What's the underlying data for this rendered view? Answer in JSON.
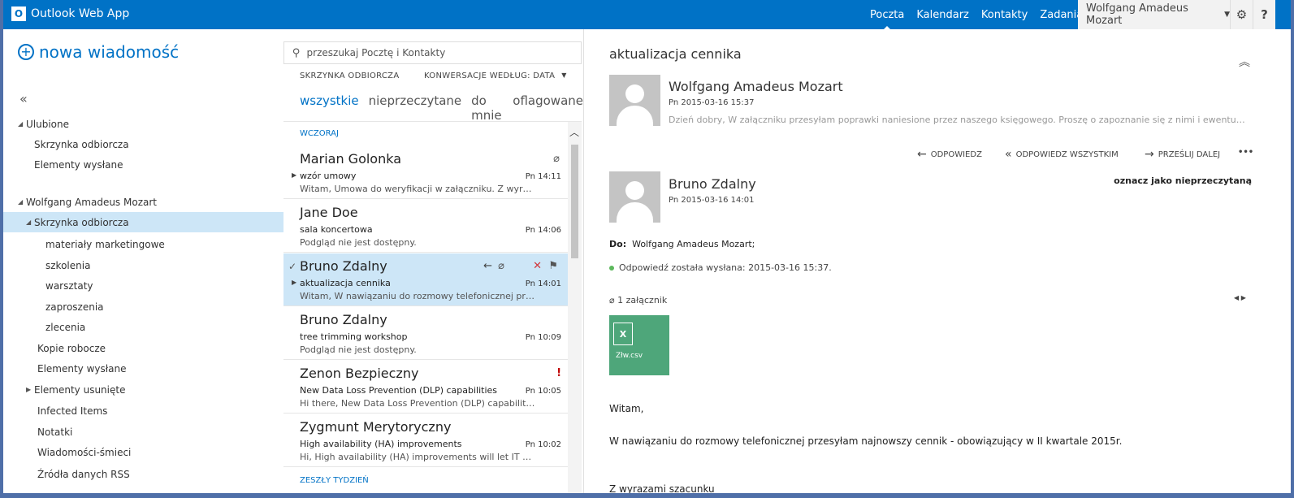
{
  "app": {
    "title": "Outlook Web App",
    "logo_letter": "O"
  },
  "nav": {
    "mail": "Poczta",
    "calendar": "Kalendarz",
    "contacts": "Kontakty",
    "tasks": "Zadania"
  },
  "user": {
    "name": "Wolfgang Amadeus Mozart"
  },
  "toolbar": {
    "gear": "⚙",
    "help": "?"
  },
  "sidebar": {
    "new_message": "nowa wiadomość",
    "favorites_header": "Ulubione",
    "favorites": [
      "Skrzynka odbiorcza",
      "Elementy wysłane"
    ],
    "account": "Wolfgang Amadeus Mozart",
    "inbox": "Skrzynka odbiorcza",
    "subfolders": [
      "materiały marketingowe",
      "szkolenia",
      "warsztaty",
      "zaproszenia",
      "zlecenia"
    ],
    "folders": [
      "Kopie robocze",
      "Elementy wysłane",
      "Elementy usunięte",
      "Infected Items",
      "Notatki",
      "Wiadomości-śmieci",
      "Źródła danych RSS"
    ]
  },
  "search": {
    "placeholder": "przeszukaj Pocztę i Kontakty"
  },
  "list": {
    "folder_label": "SKRZYNKA ODBIORCZA",
    "sort_label": "KONWERSACJE WEDŁUG: DATA",
    "filters": [
      "wszystkie",
      "nieprzeczytane",
      "do mnie",
      "oflagowane"
    ],
    "group_yesterday": "WCZORAJ",
    "group_last_week": "ZESZŁY TYDZIEŃ",
    "items": [
      {
        "sender": "Marian Golonka",
        "subject": "wzór umowy",
        "preview": "Witam, Umowa do weryfikacji w załączniku. Z wyrazami szacunku",
        "time": "Pn 14:11"
      },
      {
        "sender": "Jane Doe",
        "subject": "sala koncertowa",
        "preview": "Podgląd nie jest dostępny.",
        "time": "Pn 14:06"
      },
      {
        "sender": "Bruno Zdalny",
        "subject": "aktualizacja cennika",
        "preview": "Witam, W nawiązaniu do rozmowy telefonicznej przesyłam",
        "time": "Pn 14:01"
      },
      {
        "sender": "Bruno Zdalny",
        "subject": "tree trimming workshop",
        "preview": "Podgląd nie jest dostępny.",
        "time": "Pn 10:09"
      },
      {
        "sender": "Zenon Bezpieczny",
        "subject": "New Data Loss Prevention (DLP) capabilities",
        "preview": "Hi there, New Data Loss Prevention (DLP) capabilities will",
        "time": "Pn 10:05"
      },
      {
        "sender": "Zygmunt Merytoryczny",
        "subject": "High availability (HA) improvements",
        "preview": "Hi, High availability (HA) improvements will let IT pro...",
        "time": "Pn 10:02"
      }
    ]
  },
  "reading": {
    "title": "aktualizacja cennika",
    "msg1": {
      "from": "Wolfgang Amadeus Mozart",
      "date": "Pn 2015-03-16 15:37",
      "preview": "Dzień dobry, W załączniku przesyłam poprawki naniesione przez naszego księgowego. Proszę o zapoznanie się z nimi i ewentualny komentarz."
    },
    "actions": {
      "reply": "ODPOWIEDZ",
      "reply_all": "ODPOWIEDZ WSZYSTKIM",
      "forward": "PRZEŚLIJ DALEJ",
      "more": "•••"
    },
    "msg2": {
      "from": "Bruno Zdalny",
      "date": "Pn 2015-03-16 14:01",
      "mark_unread": "oznacz jako nieprzeczytaną",
      "to_label": "Do:",
      "to_value": "Wolfgang Amadeus Mozart;",
      "replied": "Odpowiedź została wysłana: 2015-03-16 15:37.",
      "attach_count": "1 załącznik",
      "attach_name": "Złw.csv",
      "attach_icon_letter": "X",
      "body_greeting": "Witam,",
      "body_text": "W nawiązaniu do rozmowy telefonicznej przesyłam najnowszy cennik - obowiązujący w II kwartale 2015r.",
      "body_sign": "Z wyrazami szacunku"
    }
  },
  "colors": {
    "brand": "#0072c6",
    "selected": "#cde6f7",
    "excel": "#4ea67a",
    "delete": "#d13438"
  }
}
